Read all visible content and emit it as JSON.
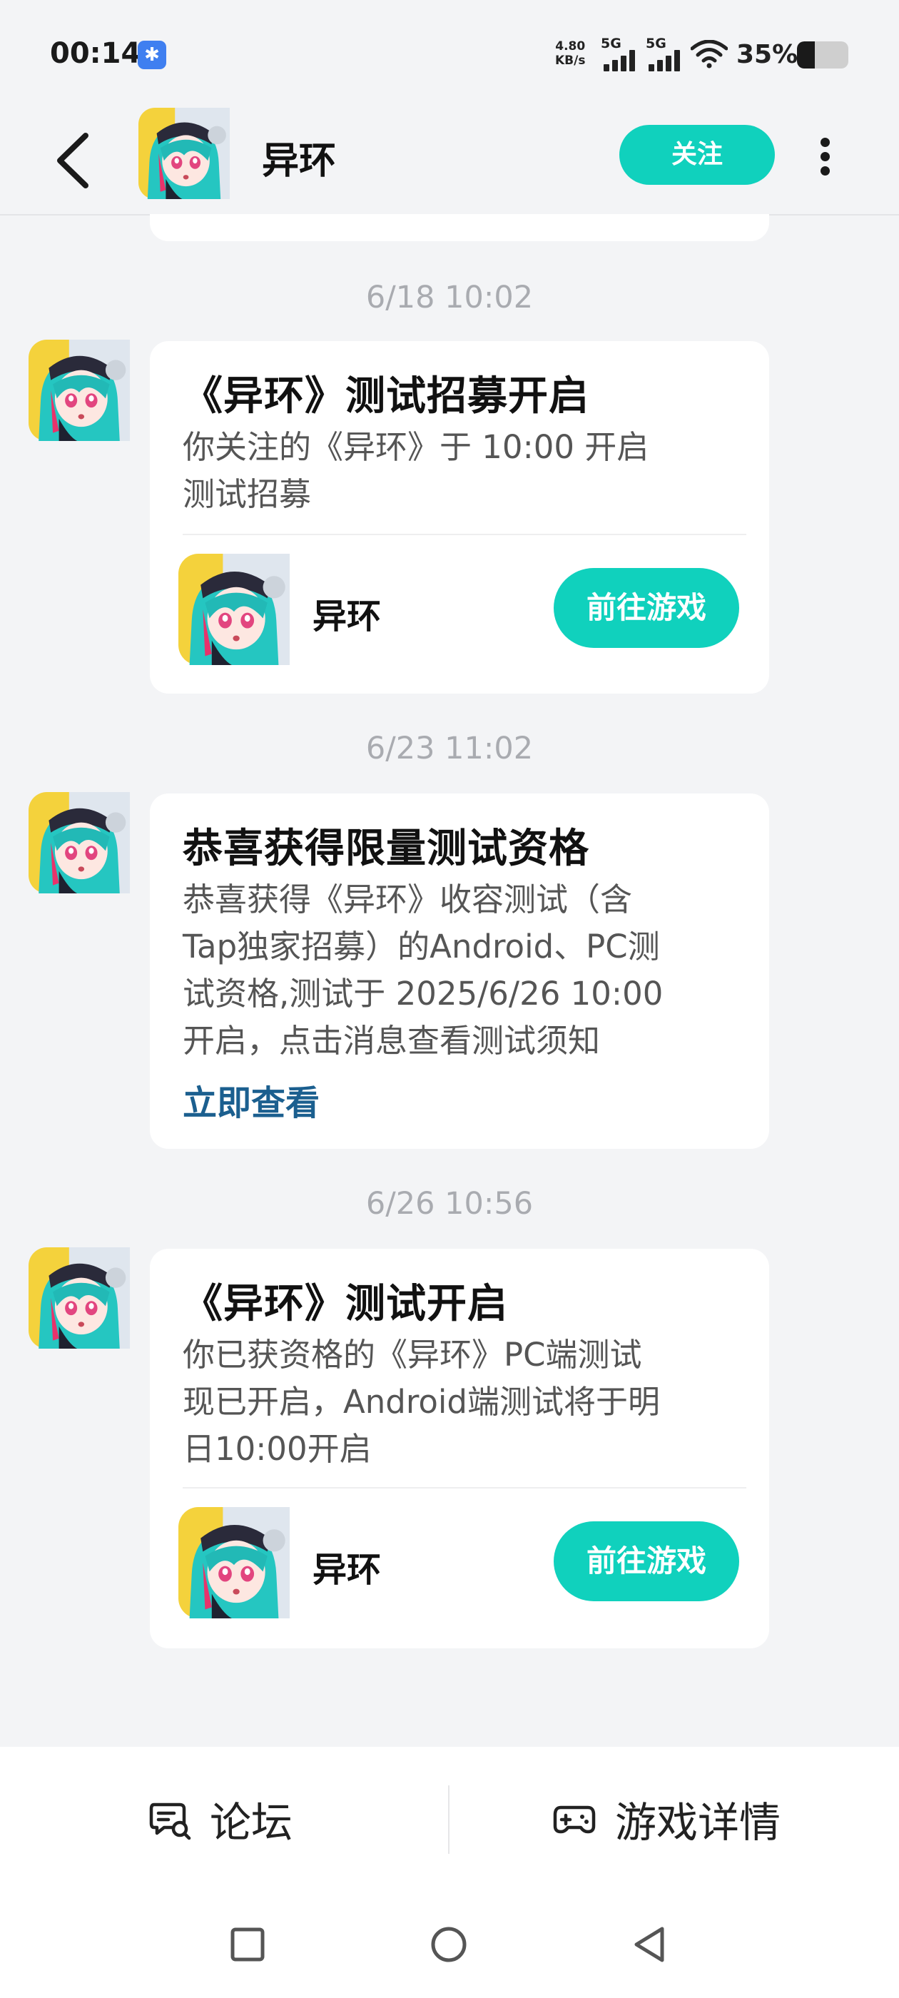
{
  "status_bar": {
    "time": "00:14",
    "net_speed_value": "4.80",
    "net_speed_unit": "KB/s",
    "signal_1": "5G",
    "signal_2": "5G",
    "battery": "35%",
    "battery_level": 0.35
  },
  "header": {
    "title": "异环",
    "follow_label": "关注"
  },
  "messages": [
    {
      "time": "6/18  10:02",
      "title": "《异环》测试招募开启",
      "body_lines": [
        "你关注的《异环》于 10:00 开启",
        "测试招募"
      ],
      "game_name": "异环",
      "button_label": "前往游戏"
    },
    {
      "time": "6/23  11:02",
      "title": "恭喜获得限量测试资格",
      "body_lines": [
        "恭喜获得《异环》收容测试（含",
        "Tap独家招募）的Android、PC测",
        "试资格,测试于 2025/6/26 10:00",
        "开启，点击消息查看测试须知"
      ],
      "link_label": "立即查看"
    },
    {
      "time": "6/26  10:56",
      "title": "《异环》测试开启",
      "body_lines": [
        "你已获资格的《异环》PC端测试",
        "现已开启，Android端测试将于明",
        "日10:00开启"
      ],
      "game_name": "异环",
      "button_label": "前往游戏"
    }
  ],
  "bottom_bar": {
    "forum_label": "论坛",
    "game_detail_label": "游戏详情"
  },
  "colors": {
    "accent": "#10d1bd",
    "link": "#1b5f8f",
    "background": "#f3f4f6"
  }
}
